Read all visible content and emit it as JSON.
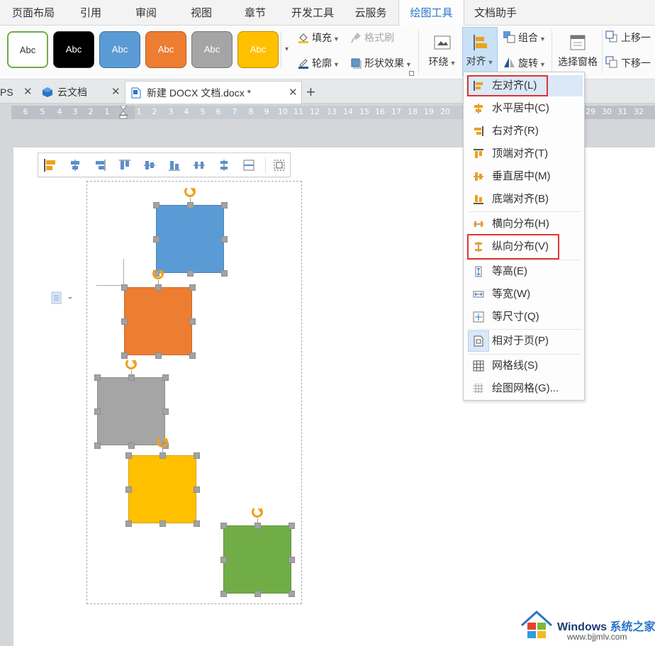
{
  "menubar": {
    "tabs": [
      "页面布局",
      "引用",
      "审阅",
      "视图",
      "章节",
      "开发工具",
      "云服务",
      "绘图工具",
      "文档助手"
    ],
    "active": "绘图工具"
  },
  "ribbon": {
    "style_label": "Abc",
    "fill": "填充",
    "format_brush": "格式刷",
    "outline": "轮廓",
    "shape_effects": "形状效果",
    "wrap": "环绕",
    "align": "对齐",
    "group": "组合",
    "rotate": "旋转",
    "selection_pane": "选择窗格",
    "bring_forward": "上移一",
    "send_backward": "下移一"
  },
  "doctabs": {
    "ps_fragment": "PS",
    "cloud_docs": "云文档",
    "current_doc": "新建 DOCX 文档.docx *",
    "add": "+"
  },
  "ruler": {
    "labels": [
      "6",
      "5",
      "4",
      "3",
      "2",
      "1",
      "1",
      "2",
      "3",
      "4",
      "5",
      "6",
      "7",
      "8",
      "9",
      "10",
      "11",
      "12",
      "13",
      "14",
      "15",
      "16",
      "17",
      "18",
      "19",
      "20",
      "29",
      "30",
      "31",
      "32"
    ]
  },
  "align_menu": {
    "items": [
      {
        "label": "左对齐(L)",
        "icon": "align-left-icon",
        "highlighted": true,
        "boxed": true
      },
      {
        "label": "水平居中(C)",
        "icon": "align-center-icon"
      },
      {
        "label": "右对齐(R)",
        "icon": "align-right-icon"
      },
      {
        "label": "顶端对齐(T)",
        "icon": "align-top-icon"
      },
      {
        "label": "垂直居中(M)",
        "icon": "align-middle-icon"
      },
      {
        "label": "底端对齐(B)",
        "icon": "align-bottom-icon"
      },
      {
        "label": "横向分布(H)",
        "icon": "distribute-horizontal-icon"
      },
      {
        "label": "纵向分布(V)",
        "icon": "distribute-vertical-icon",
        "boxed": true
      },
      {
        "label": "等高(E)",
        "icon": "same-height-icon"
      },
      {
        "label": "等宽(W)",
        "icon": "same-width-icon"
      },
      {
        "label": "等尺寸(Q)",
        "icon": "same-size-icon"
      },
      {
        "label": "相对于页(P)",
        "icon": "relative-to-page-icon",
        "checked": true
      },
      {
        "label": "网格线(S)",
        "icon": "gridlines-icon"
      },
      {
        "label": "绘图网格(G)...",
        "icon": "drawing-grid-icon"
      }
    ]
  },
  "shapes": [
    {
      "name": "blue",
      "color": "#5b9bd5"
    },
    {
      "name": "orange",
      "color": "#ed7d31"
    },
    {
      "name": "gray",
      "color": "#a5a5a5"
    },
    {
      "name": "yellow",
      "color": "#ffc000"
    },
    {
      "name": "green",
      "color": "#70ad47"
    }
  ],
  "watermark": {
    "brand": "Windows",
    "brand_cn": "系统之家",
    "url": "www.bjjmlv.com"
  },
  "colors": {
    "accent": "#2b74c9",
    "highlight_box": "#e03232"
  }
}
